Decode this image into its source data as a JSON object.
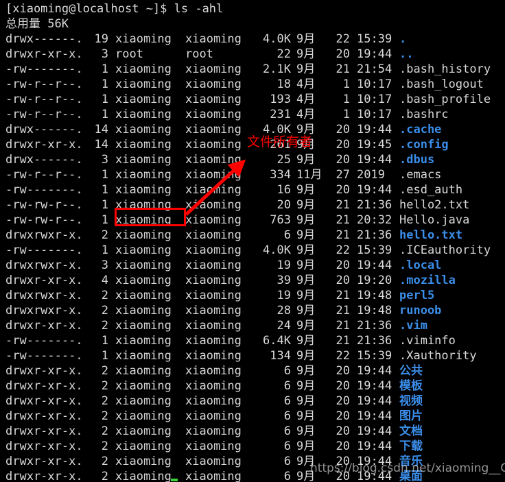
{
  "terminal": {
    "background": "#000000",
    "foreground": "#d9d9d9",
    "dir_color": "#3b8eea",
    "annotation_color": "#ff0000",
    "cursor_color": "#3cd13c",
    "prompt_line": "[xiaoming@localhost ~]$ ls -ahl",
    "total_line": "总用量 56K"
  },
  "listing": {
    "rows": [
      {
        "perm": "drwx------.",
        "links": "19",
        "owner": "xiaoming",
        "group": "xiaoming",
        "size": "4.0K",
        "month": "9月",
        "day": "22",
        "time": "15:39",
        "name": ".",
        "type": "dir"
      },
      {
        "perm": "drwxr-xr-x.",
        "links": "3",
        "owner": "root",
        "group": "root",
        "size": "22",
        "month": "9月",
        "day": "20",
        "time": "19:44",
        "name": "..",
        "type": "dir"
      },
      {
        "perm": "-rw-------.",
        "links": "1",
        "owner": "xiaoming",
        "group": "xiaoming",
        "size": "2.1K",
        "month": "9月",
        "day": "21",
        "time": "21:54",
        "name": ".bash_history",
        "type": "file"
      },
      {
        "perm": "-rw-r--r--.",
        "links": "1",
        "owner": "xiaoming",
        "group": "xiaoming",
        "size": "18",
        "month": "4月",
        "day": "1",
        "time": "10:17",
        "name": ".bash_logout",
        "type": "file"
      },
      {
        "perm": "-rw-r--r--.",
        "links": "1",
        "owner": "xiaoming",
        "group": "xiaoming",
        "size": "193",
        "month": "4月",
        "day": "1",
        "time": "10:17",
        "name": ".bash_profile",
        "type": "file"
      },
      {
        "perm": "-rw-r--r--.",
        "links": "1",
        "owner": "xiaoming",
        "group": "xiaoming",
        "size": "231",
        "month": "4月",
        "day": "1",
        "time": "10:17",
        "name": ".bashrc",
        "type": "file"
      },
      {
        "perm": "drwx------.",
        "links": "14",
        "owner": "xiaoming",
        "group": "xiaoming",
        "size": "4.0K",
        "month": "9月",
        "day": "20",
        "time": "19:44",
        "name": ".cache",
        "type": "dir"
      },
      {
        "perm": "drwxr-xr-x.",
        "links": "14",
        "owner": "xiaoming",
        "group": "xiaoming",
        "size": "261",
        "month": "9月",
        "day": "20",
        "time": "19:45",
        "name": ".config",
        "type": "dir"
      },
      {
        "perm": "drwx------.",
        "links": "3",
        "owner": "xiaoming",
        "group": "xiaoming",
        "size": "25",
        "month": "9月",
        "day": "20",
        "time": "19:44",
        "name": ".dbus",
        "type": "dir"
      },
      {
        "perm": "-rw-r--r--.",
        "links": "1",
        "owner": "xiaoming",
        "group": "xiaoming",
        "size": "334",
        "month": "11月",
        "day": "27",
        "time": "2019",
        "name": ".emacs",
        "type": "file"
      },
      {
        "perm": "-rw-------.",
        "links": "1",
        "owner": "xiaoming",
        "group": "xiaoming",
        "size": "16",
        "month": "9月",
        "day": "20",
        "time": "19:44",
        "name": ".esd_auth",
        "type": "file"
      },
      {
        "perm": "-rw-rw-r--.",
        "links": "1",
        "owner": "xiaoming",
        "group": "xiaoming",
        "size": "20",
        "month": "9月",
        "day": "21",
        "time": "21:36",
        "name": "hello2.txt",
        "type": "file"
      },
      {
        "perm": "-rw-rw-r--.",
        "links": "1",
        "owner": "xiaoming",
        "group": "xiaoming",
        "size": "763",
        "month": "9月",
        "day": "21",
        "time": "20:32",
        "name": "Hello.java",
        "type": "file"
      },
      {
        "perm": "drwxrwxr-x.",
        "links": "2",
        "owner": "xiaoming",
        "group": "xiaoming",
        "size": "6",
        "month": "9月",
        "day": "21",
        "time": "21:36",
        "name": "hello.txt",
        "type": "dir"
      },
      {
        "perm": "-rw-------.",
        "links": "1",
        "owner": "xiaoming",
        "group": "xiaoming",
        "size": "4.0K",
        "month": "9月",
        "day": "22",
        "time": "15:39",
        "name": ".ICEauthority",
        "type": "file"
      },
      {
        "perm": "drwxrwxr-x.",
        "links": "3",
        "owner": "xiaoming",
        "group": "xiaoming",
        "size": "19",
        "month": "9月",
        "day": "20",
        "time": "19:44",
        "name": ".local",
        "type": "dir"
      },
      {
        "perm": "drwxr-xr-x.",
        "links": "4",
        "owner": "xiaoming",
        "group": "xiaoming",
        "size": "39",
        "month": "9月",
        "day": "20",
        "time": "19:20",
        "name": ".mozilla",
        "type": "dir"
      },
      {
        "perm": "drwxrwxr-x.",
        "links": "2",
        "owner": "xiaoming",
        "group": "xiaoming",
        "size": "19",
        "month": "9月",
        "day": "21",
        "time": "19:48",
        "name": "perl5",
        "type": "dir"
      },
      {
        "perm": "drwxrwxr-x.",
        "links": "2",
        "owner": "xiaoming",
        "group": "xiaoming",
        "size": "28",
        "month": "9月",
        "day": "21",
        "time": "19:48",
        "name": "runoob",
        "type": "dir"
      },
      {
        "perm": "drwxr-xr-x.",
        "links": "2",
        "owner": "xiaoming",
        "group": "xiaoming",
        "size": "24",
        "month": "9月",
        "day": "21",
        "time": "21:36",
        "name": ".vim",
        "type": "dir"
      },
      {
        "perm": "-rw-------.",
        "links": "1",
        "owner": "xiaoming",
        "group": "xiaoming",
        "size": "6.4K",
        "month": "9月",
        "day": "21",
        "time": "21:36",
        "name": ".viminfo",
        "type": "file"
      },
      {
        "perm": "-rw-------.",
        "links": "1",
        "owner": "xiaoming",
        "group": "xiaoming",
        "size": "134",
        "month": "9月",
        "day": "22",
        "time": "15:39",
        "name": ".Xauthority",
        "type": "file"
      },
      {
        "perm": "drwxr-xr-x.",
        "links": "2",
        "owner": "xiaoming",
        "group": "xiaoming",
        "size": "6",
        "month": "9月",
        "day": "20",
        "time": "19:44",
        "name": "公共",
        "type": "dir"
      },
      {
        "perm": "drwxr-xr-x.",
        "links": "2",
        "owner": "xiaoming",
        "group": "xiaoming",
        "size": "6",
        "month": "9月",
        "day": "20",
        "time": "19:44",
        "name": "模板",
        "type": "dir"
      },
      {
        "perm": "drwxr-xr-x.",
        "links": "2",
        "owner": "xiaoming",
        "group": "xiaoming",
        "size": "6",
        "month": "9月",
        "day": "20",
        "time": "19:44",
        "name": "视频",
        "type": "dir"
      },
      {
        "perm": "drwxr-xr-x.",
        "links": "2",
        "owner": "xiaoming",
        "group": "xiaoming",
        "size": "6",
        "month": "9月",
        "day": "20",
        "time": "19:44",
        "name": "图片",
        "type": "dir"
      },
      {
        "perm": "drwxr-xr-x.",
        "links": "2",
        "owner": "xiaoming",
        "group": "xiaoming",
        "size": "6",
        "month": "9月",
        "day": "20",
        "time": "19:44",
        "name": "文档",
        "type": "dir"
      },
      {
        "perm": "drwxr-xr-x.",
        "links": "2",
        "owner": "xiaoming",
        "group": "xiaoming",
        "size": "6",
        "month": "9月",
        "day": "20",
        "time": "19:44",
        "name": "下载",
        "type": "dir"
      },
      {
        "perm": "drwxr-xr-x.",
        "links": "2",
        "owner": "xiaoming",
        "group": "xiaoming",
        "size": "6",
        "month": "9月",
        "day": "20",
        "time": "19:44",
        "name": "音乐",
        "type": "dir"
      },
      {
        "perm": "drwxr-xr-x.",
        "links": "2",
        "owner": "xiaoming",
        "group": "xiaoming",
        "size": "6",
        "month": "9月",
        "day": "20",
        "time": "19:44",
        "name": "桌面",
        "type": "dir"
      }
    ]
  },
  "annotations": {
    "owner_label": "文件所有者"
  },
  "watermark": {
    "text": "https://blog.csdn.net/xiaoming__CSDN"
  }
}
